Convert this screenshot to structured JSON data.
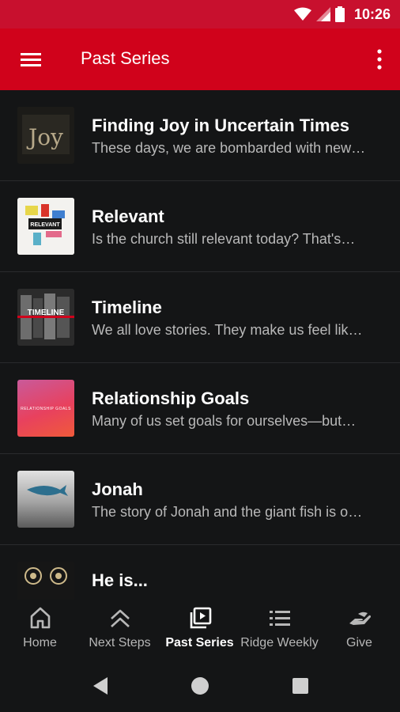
{
  "status_bar": {
    "time": "10:26"
  },
  "app_bar": {
    "title": "Past Series"
  },
  "series": [
    {
      "title": "Finding Joy in Uncertain Times",
      "description": "These days, we are bombarded with new…",
      "thumb_text": "Joy"
    },
    {
      "title": "Relevant",
      "description": "Is the church still relevant today? That's…",
      "thumb_text": "RELEVANT"
    },
    {
      "title": "Timeline",
      "description": "We all love stories. They make us feel lik…",
      "thumb_text": "TIMELINE"
    },
    {
      "title": "Relationship Goals",
      "description": "Many of us set goals for ourselves—but…",
      "thumb_text": "RELATIONSHIP GOALS"
    },
    {
      "title": "Jonah",
      "description": "The story of Jonah and the giant fish is o…",
      "thumb_text": ""
    },
    {
      "title": "He is...",
      "description": "",
      "thumb_text": ""
    }
  ],
  "bottom_nav": [
    {
      "label": "Home",
      "icon": "home-icon"
    },
    {
      "label": "Next Steps",
      "icon": "double-chevron-up-icon"
    },
    {
      "label": "Past Series",
      "icon": "video-library-icon",
      "active": true
    },
    {
      "label": "Ridge Weekly",
      "icon": "list-icon"
    },
    {
      "label": "Give",
      "icon": "give-hand-icon"
    }
  ],
  "colors": {
    "accent": "#d0021b",
    "status_bar": "#c8102e",
    "background": "#141516"
  }
}
